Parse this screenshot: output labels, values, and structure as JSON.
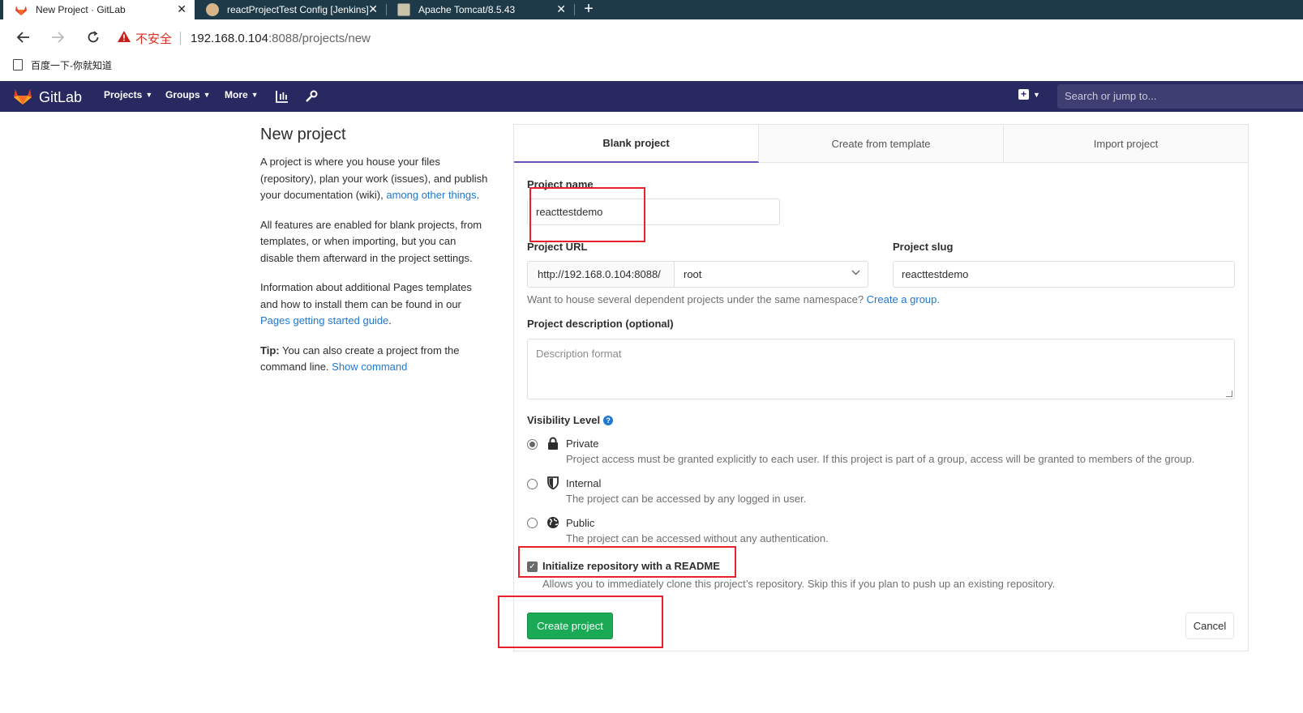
{
  "browser": {
    "tabs": [
      {
        "title": "New Project · GitLab",
        "active": true
      },
      {
        "title": "reactProjectTest Config [Jenkins]",
        "active": false
      },
      {
        "title": "Apache Tomcat/8.5.43",
        "active": false
      }
    ],
    "close_glyph": "✕",
    "new_tab_glyph": "+",
    "address": {
      "security_label": "不安全",
      "host": "192.168.0.104",
      "path": ":8088/projects/new"
    },
    "bookmark": "百度一下-你就知道"
  },
  "gitlab_header": {
    "brand": "GitLab",
    "nav": [
      "Projects",
      "Groups",
      "More"
    ],
    "search_placeholder": "Search or jump to..."
  },
  "intro": {
    "title": "New project",
    "p1_text": "A project is where you house your files (repository), plan your work (issues), and publish your documentation (wiki), ",
    "p1_link": "among other things",
    "p1_end": ".",
    "p2": "All features are enabled for blank projects, from templates, or when importing, but you can disable them afterward in the project settings.",
    "p3_text": "Information about additional Pages templates and how to install them can be found in our ",
    "p3_link": "Pages getting started guide",
    "p3_end": ".",
    "tip_label": "Tip:",
    "tip_text": " You can also create a project from the command line. ",
    "tip_link": "Show command"
  },
  "panel": {
    "tabs": [
      "Blank project",
      "Create from template",
      "Import project"
    ],
    "project_name_label": "Project name",
    "project_name_value": "reacttestdemo",
    "project_url_label": "Project URL",
    "url_prefix": "http://192.168.0.104:8088/",
    "namespace": "root",
    "project_slug_label": "Project slug",
    "project_slug_value": "reacttestdemo",
    "namespace_help": "Want to house several dependent projects under the same namespace? ",
    "namespace_help_link": "Create a group.",
    "description_label": "Project description (optional)",
    "description_placeholder": "Description format",
    "visibility_label": "Visibility Level",
    "visibility": [
      {
        "title": "Private",
        "desc": "Project access must be granted explicitly to each user. If this project is part of a group, access will be granted to members of the group.",
        "checked": true
      },
      {
        "title": "Internal",
        "desc": "The project can be accessed by any logged in user.",
        "checked": false
      },
      {
        "title": "Public",
        "desc": "The project can be accessed without any authentication.",
        "checked": false
      }
    ],
    "readme_label": "Initialize repository with a README",
    "readme_desc": "Allows you to immediately clone this project’s repository. Skip this if you plan to push up an existing repository.",
    "create_button": "Create project",
    "cancel_button": "Cancel"
  },
  "colors": {
    "header_bg": "#292961",
    "accent_purple": "#6b4fbb",
    "create_green": "#1aaa55",
    "link_blue": "#1f78d1",
    "annotation_red": "#e8212a"
  }
}
